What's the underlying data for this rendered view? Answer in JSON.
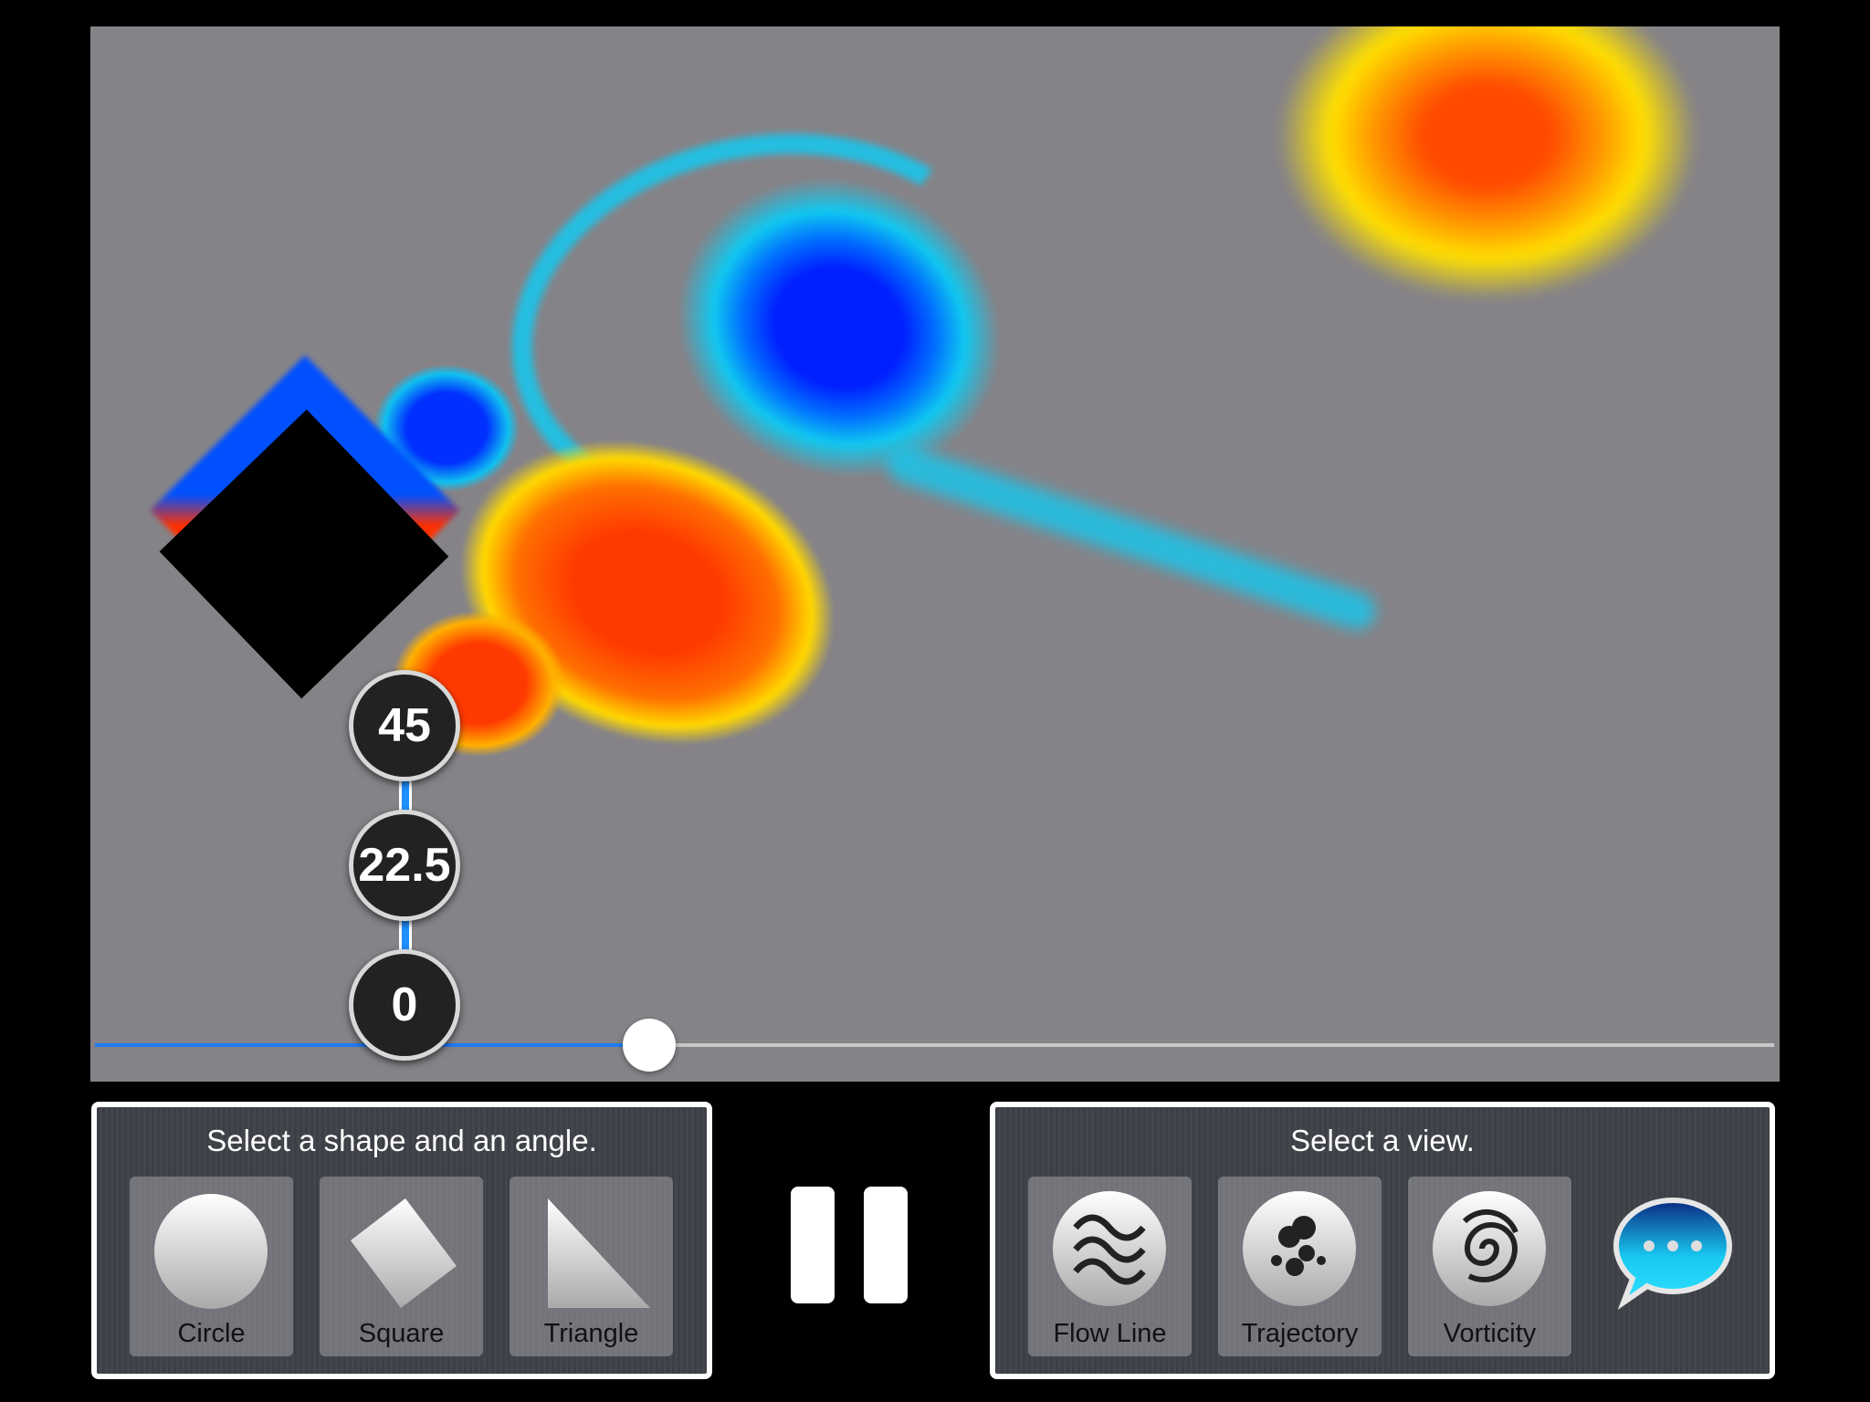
{
  "simulation": {
    "angles": [
      "45",
      "22.5",
      "0"
    ],
    "time_slider_value": 0.33,
    "colors": {
      "background": "#858388",
      "positive": "#ff5000",
      "negative": "#0040ff",
      "obstacle": "#000000"
    }
  },
  "shape_panel": {
    "title": "Select a shape and an angle.",
    "items": [
      {
        "label": "Circle",
        "icon": "circle-icon"
      },
      {
        "label": "Square",
        "icon": "square-icon"
      },
      {
        "label": "Triangle",
        "icon": "triangle-icon"
      }
    ]
  },
  "playback": {
    "icon": "pause-icon"
  },
  "view_panel": {
    "title": "Select a view.",
    "items": [
      {
        "label": "Flow Line",
        "icon": "waves-icon"
      },
      {
        "label": "Trajectory",
        "icon": "particles-icon"
      },
      {
        "label": "Vorticity",
        "icon": "spiral-icon"
      }
    ],
    "more_icon": "chat-bubble-icon"
  }
}
